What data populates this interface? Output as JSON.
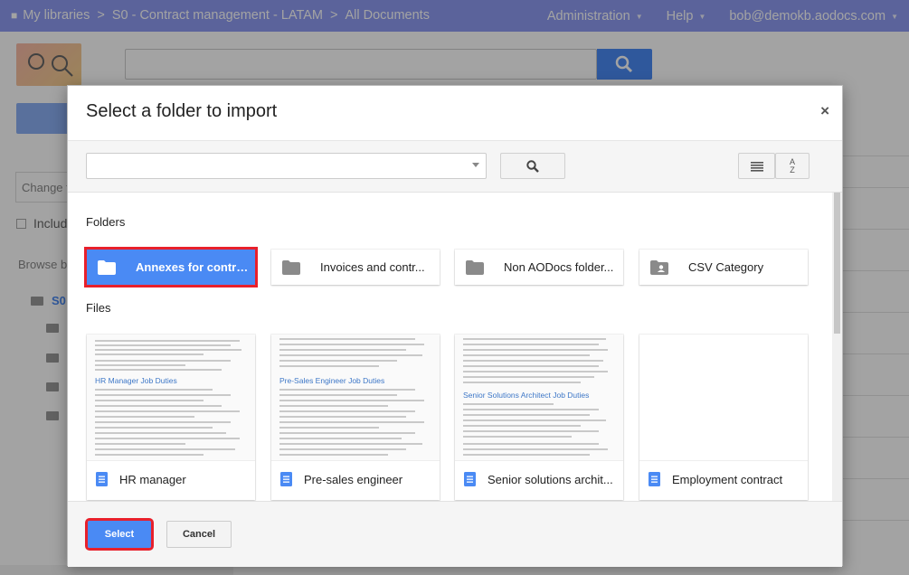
{
  "topbar": {
    "breadcrumbs": [
      "My libraries",
      "S0 - Contract management - LATAM",
      "All Documents"
    ],
    "separator": ">",
    "menu": [
      "Administration",
      "Help"
    ],
    "user": "bob@demokb.aodocs.com"
  },
  "background": {
    "change_placeholder": "Change t",
    "include_label": "Includ",
    "browse_label": "Browse b",
    "tree_root": "S0"
  },
  "dialog": {
    "title": "Select a folder to import",
    "close_glyph": "×",
    "sort_glyph": "A\nZ",
    "sections": {
      "folders": "Folders",
      "files": "Files"
    },
    "folders": [
      {
        "name": "Annexes for contra...",
        "selected": true,
        "icon": "folder-icon"
      },
      {
        "name": "Invoices and contr...",
        "selected": false,
        "icon": "folder-icon"
      },
      {
        "name": "Non AODocs folder...",
        "selected": false,
        "icon": "folder-icon"
      },
      {
        "name": "CSV Category",
        "selected": false,
        "icon": "shared-folder-icon"
      }
    ],
    "files": [
      {
        "name": "HR manager",
        "preview_heading": "HR Manager Job Duties",
        "icon": "doc-icon"
      },
      {
        "name": "Pre-sales engineer",
        "preview_heading": "Pre-Sales Engineer Job Duties",
        "icon": "doc-icon"
      },
      {
        "name": "Senior solutions archit...",
        "preview_heading": "Senior Solutions Architect Job Duties",
        "icon": "doc-icon"
      },
      {
        "name": "Employment contract",
        "preview_heading": "",
        "icon": "doc-icon"
      }
    ],
    "buttons": {
      "select": "Select",
      "cancel": "Cancel"
    }
  },
  "colors": {
    "topbar": "#8f9bf2",
    "accent": "#4a8af4",
    "highlight": "#e8202b"
  }
}
